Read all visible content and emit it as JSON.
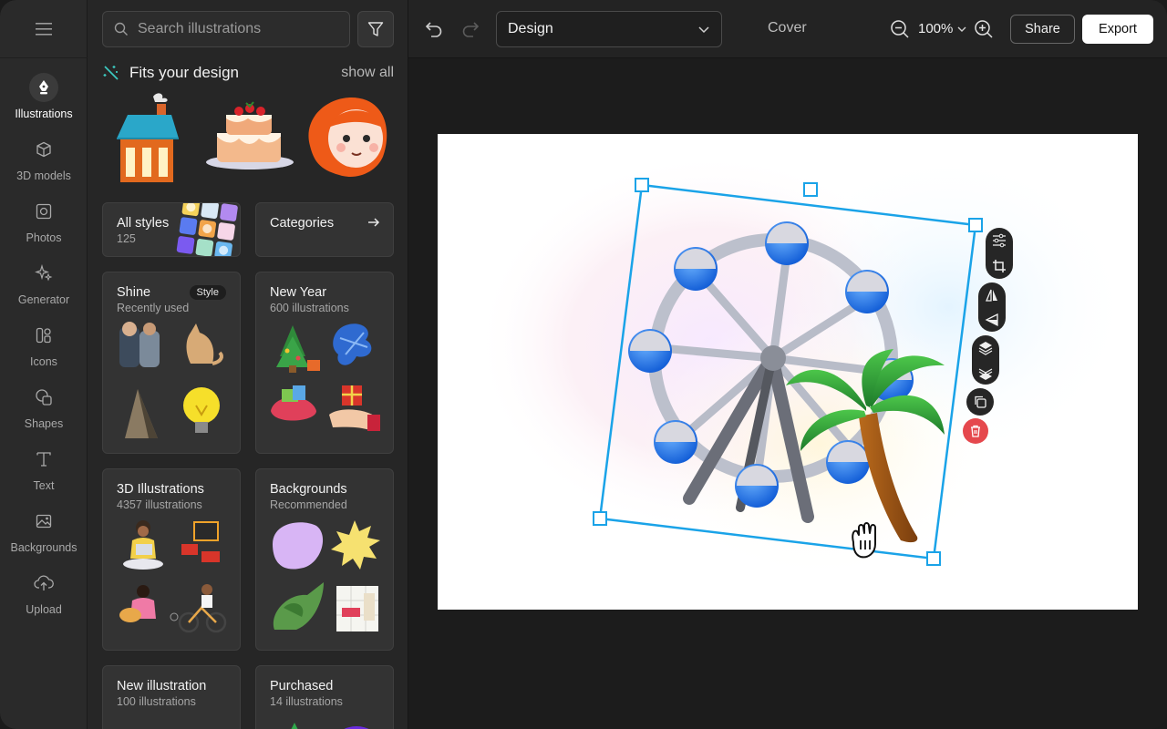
{
  "rail": {
    "menu_icon": "hamburger-icon",
    "items": [
      {
        "label": "Illustrations",
        "icon": "pen-nib-icon",
        "active": true
      },
      {
        "label": "3D models",
        "icon": "cube-icon",
        "active": false
      },
      {
        "label": "Photos",
        "icon": "photo-frame-icon",
        "active": false
      },
      {
        "label": "Generator",
        "icon": "sparkles-icon",
        "active": false
      },
      {
        "label": "Icons",
        "icon": "icons-grid-icon",
        "active": false
      },
      {
        "label": "Shapes",
        "icon": "shapes-icon",
        "active": false
      },
      {
        "label": "Text",
        "icon": "text-t-icon",
        "active": false
      },
      {
        "label": "Backgrounds",
        "icon": "image-icon",
        "active": false
      },
      {
        "label": "Upload",
        "icon": "cloud-upload-icon",
        "active": false
      }
    ]
  },
  "panel": {
    "search": {
      "placeholder": "Search illustrations",
      "value": ""
    },
    "fits": {
      "title": "Fits your design",
      "show_all": "show all"
    },
    "cards": [
      {
        "title": "All styles",
        "subtitle": "125"
      },
      {
        "title": "Categories",
        "subtitle": ""
      },
      {
        "title": "Shine",
        "subtitle": "Recently used",
        "badge": "Style"
      },
      {
        "title": "New Year",
        "subtitle": "600 illustrations"
      },
      {
        "title": "3D Illustrations",
        "subtitle": "4357 illustrations"
      },
      {
        "title": "Backgrounds",
        "subtitle": "Recommended"
      },
      {
        "title": "New illustration",
        "subtitle": "100 illustrations"
      },
      {
        "title": "Purchased",
        "subtitle": "14 illustrations"
      }
    ]
  },
  "topbar": {
    "design_select": "Design",
    "cover": "Cover",
    "zoom": "100%",
    "share": "Share",
    "export": "Export"
  },
  "colors": {
    "selection": "#1aa3e8",
    "delete": "#e5484d",
    "accent_blue": "#2f7fe8"
  }
}
